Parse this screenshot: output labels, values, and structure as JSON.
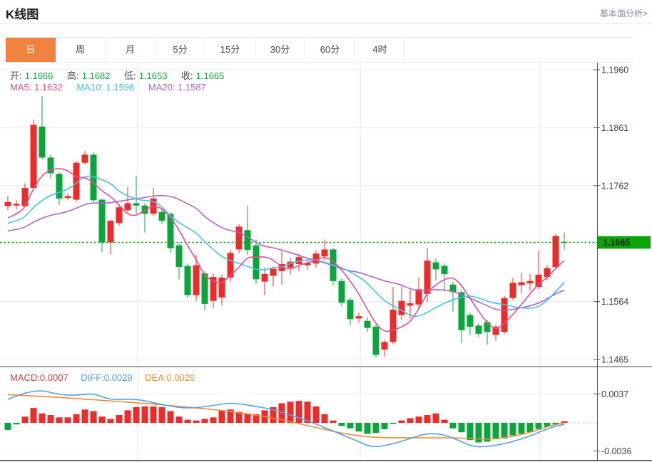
{
  "header": {
    "title": "K线图",
    "link": "基本面分析>"
  },
  "tabs": {
    "items": [
      {
        "label": "日",
        "active": true
      },
      {
        "label": "周",
        "active": false
      },
      {
        "label": "月",
        "active": false
      },
      {
        "label": "5分",
        "active": false
      },
      {
        "label": "15分",
        "active": false
      },
      {
        "label": "30分",
        "active": false
      },
      {
        "label": "60分",
        "active": false
      },
      {
        "label": "4时",
        "active": false
      }
    ]
  },
  "ohlc": {
    "open_label": "开:",
    "open": "1.1666",
    "high_label": "高:",
    "high": "1.1682",
    "low_label": "低:",
    "low": "1.1653",
    "close_label": "收:",
    "close": "1.1665"
  },
  "ma": {
    "ma5": "MA5: 1.1632",
    "ma10": "MA10: 1.1596",
    "ma20": "MA20: 1.1587"
  },
  "macd_header": {
    "macd": "MACD:0.0007",
    "diff": "DIFF:0.0029",
    "dea": "DEA:0.0026"
  },
  "colors": {
    "up": "#ee2b2b",
    "down": "#0ba53c",
    "ma5": "#ec4d8b",
    "ma10": "#45c4e4",
    "ma20": "#b263c6",
    "diff": "#55a0e6",
    "dea": "#ef8d35",
    "price_line": "#12a112",
    "tag_bg": "#0aa30a",
    "tag_text": "#0d2b0d",
    "grid": "#e9edf3",
    "vgrid": "#e2e7ee",
    "axis": "#54575e",
    "zero_dash": "#a8d2ef",
    "tick_text": "#3c3f44",
    "tab_active": "#f0823f"
  },
  "chart_data": {
    "type": "candlestick+macd",
    "title": "K线图 (日)",
    "price_axis": {
      "ticks": [
        1.196,
        1.1861,
        1.1762,
        1.1564,
        1.1465
      ],
      "current": 1.1665,
      "current_label": "1.1665",
      "top_price": 1.196,
      "bottom_price": 1.1465
    },
    "macd_axis": {
      "ticks": [
        0.0037,
        -0.0036
      ]
    },
    "grid_x": [
      193,
      505,
      757
    ],
    "candles": [
      [
        1.1727,
        1.1744,
        1.172,
        1.1734
      ],
      [
        1.1728,
        1.1737,
        1.1722,
        1.1731
      ],
      [
        1.1727,
        1.1766,
        1.1725,
        1.1758
      ],
      [
        1.1758,
        1.1875,
        1.1756,
        1.1866
      ],
      [
        1.1863,
        1.1915,
        1.1807,
        1.181
      ],
      [
        1.181,
        1.1815,
        1.1774,
        1.1783
      ],
      [
        1.1782,
        1.1785,
        1.1729,
        1.174
      ],
      [
        1.1741,
        1.1748,
        1.1737,
        1.1744
      ],
      [
        1.1738,
        1.1804,
        1.1735,
        1.1801
      ],
      [
        1.1801,
        1.1821,
        1.1798,
        1.1815
      ],
      [
        1.1815,
        1.1819,
        1.1734,
        1.1737
      ],
      [
        1.1738,
        1.174,
        1.1648,
        1.1665
      ],
      [
        1.1665,
        1.1704,
        1.1644,
        1.1702
      ],
      [
        1.1698,
        1.1731,
        1.1694,
        1.1725
      ],
      [
        1.172,
        1.176,
        1.1716,
        1.1732
      ],
      [
        1.1732,
        1.1779,
        1.1714,
        1.1728
      ],
      [
        1.1728,
        1.1732,
        1.1682,
        1.1714
      ],
      [
        1.1714,
        1.1758,
        1.171,
        1.174
      ],
      [
        1.1717,
        1.1721,
        1.1697,
        1.1702
      ],
      [
        1.1714,
        1.1716,
        1.1647,
        1.1655
      ],
      [
        1.166,
        1.1663,
        1.1602,
        1.1623
      ],
      [
        1.1625,
        1.1629,
        1.1571,
        1.1575
      ],
      [
        1.1575,
        1.1644,
        1.1565,
        1.1626
      ],
      [
        1.1612,
        1.1616,
        1.1549,
        1.156
      ],
      [
        1.1565,
        1.1612,
        1.1553,
        1.1606
      ],
      [
        1.1571,
        1.161,
        1.1557,
        1.1605
      ],
      [
        1.1605,
        1.1652,
        1.1598,
        1.1647
      ],
      [
        1.1653,
        1.1696,
        1.1646,
        1.1692
      ],
      [
        1.1686,
        1.1728,
        1.1644,
        1.1652
      ],
      [
        1.166,
        1.167,
        1.1594,
        1.1602
      ],
      [
        1.1598,
        1.1622,
        1.1575,
        1.1611
      ],
      [
        1.1608,
        1.1624,
        1.159,
        1.162
      ],
      [
        1.1616,
        1.165,
        1.1593,
        1.1628
      ],
      [
        1.1622,
        1.1638,
        1.161,
        1.1632
      ],
      [
        1.1628,
        1.1645,
        1.1616,
        1.164
      ],
      [
        1.1626,
        1.1636,
        1.1618,
        1.163
      ],
      [
        1.1629,
        1.1652,
        1.1622,
        1.1646
      ],
      [
        1.1641,
        1.167,
        1.1634,
        1.1653
      ],
      [
        1.1653,
        1.1656,
        1.1592,
        1.1599
      ],
      [
        1.1599,
        1.1604,
        1.1556,
        1.1562
      ],
      [
        1.1567,
        1.1571,
        1.1523,
        1.1534
      ],
      [
        1.1535,
        1.1545,
        1.1528,
        1.1539
      ],
      [
        1.1531,
        1.1537,
        1.1512,
        1.1519
      ],
      [
        1.1521,
        1.1525,
        1.1469,
        1.1473
      ],
      [
        1.1482,
        1.1499,
        1.147,
        1.1495
      ],
      [
        1.1495,
        1.1589,
        1.1491,
        1.155
      ],
      [
        1.1541,
        1.1589,
        1.1532,
        1.1565
      ],
      [
        1.1557,
        1.1584,
        1.1535,
        1.1561
      ],
      [
        1.1559,
        1.1605,
        1.1553,
        1.1585
      ],
      [
        1.1577,
        1.1655,
        1.1563,
        1.1634
      ],
      [
        1.1631,
        1.1638,
        1.16,
        1.1619
      ],
      [
        1.1625,
        1.1629,
        1.1581,
        1.1611
      ],
      [
        1.1593,
        1.1598,
        1.1547,
        1.158
      ],
      [
        1.158,
        1.1584,
        1.1493,
        1.1515
      ],
      [
        1.1541,
        1.1545,
        1.1507,
        1.1521
      ],
      [
        1.1523,
        1.1527,
        1.1503,
        1.1509
      ],
      [
        1.1529,
        1.1533,
        1.149,
        1.1512
      ],
      [
        1.1507,
        1.1525,
        1.1497,
        1.1521
      ],
      [
        1.1512,
        1.1574,
        1.1508,
        1.157
      ],
      [
        1.157,
        1.1604,
        1.1566,
        1.1596
      ],
      [
        1.1592,
        1.1613,
        1.1577,
        1.1597
      ],
      [
        1.1595,
        1.1611,
        1.1582,
        1.1599
      ],
      [
        1.1589,
        1.1651,
        1.1585,
        1.161
      ],
      [
        1.1606,
        1.1626,
        1.1601,
        1.1621
      ],
      [
        1.1623,
        1.168,
        1.1619,
        1.1676
      ],
      [
        1.1666,
        1.1682,
        1.1653,
        1.1665
      ]
    ],
    "ma_pads": {
      "ma5": 1.17,
      "ma10": 1.1694,
      "ma20": 1.1682
    },
    "macd": {
      "hist": [
        -0.0009,
        -0.0002,
        0.0008,
        0.0019,
        0.0012,
        0.001,
        0.0007,
        0.0007,
        0.0011,
        0.0017,
        0.0015,
        0.0008,
        0.0005,
        0.001,
        0.0016,
        0.002,
        0.0021,
        0.0021,
        0.002,
        0.0015,
        0.0008,
        0.0004,
        0.0003,
        0.0005,
        0.0007,
        0.0016,
        0.0017,
        0.0014,
        0.0012,
        0.0011,
        0.0016,
        0.002,
        0.0025,
        0.0027,
        0.0028,
        0.0027,
        0.0021,
        0.0011,
        0.0003,
        -0.0004,
        -0.0007,
        -0.0011,
        -0.0014,
        -0.0013,
        -0.0008,
        -0.0001,
        0.0003,
        0.0006,
        0.0008,
        0.001,
        0.0012,
        0.0004,
        -0.0007,
        -0.0012,
        -0.0022,
        -0.0025,
        -0.0024,
        -0.0021,
        -0.002,
        -0.0016,
        -0.0014,
        -0.0012,
        -0.0008,
        -0.0005,
        -0.0002,
        0.0002
      ],
      "diff_points": [
        [
          1,
          0.003
        ],
        [
          4,
          0.0044
        ],
        [
          7,
          0.0036
        ],
        [
          9,
          0.0035
        ],
        [
          11,
          0.0038
        ],
        [
          13,
          0.0029
        ],
        [
          16,
          0.0031
        ],
        [
          19,
          0.0023
        ],
        [
          22,
          0.0018
        ],
        [
          25,
          0.0022
        ],
        [
          27,
          0.0026
        ],
        [
          30,
          0.0021
        ],
        [
          32,
          0.0017
        ],
        [
          34,
          0.001
        ],
        [
          36,
          0.0003
        ],
        [
          38,
          -0.0006
        ],
        [
          40,
          -0.0015
        ],
        [
          42,
          -0.0024
        ],
        [
          43,
          -0.0029
        ],
        [
          44,
          -0.0031
        ],
        [
          46,
          -0.0027
        ],
        [
          48,
          -0.002
        ],
        [
          50,
          -0.0013
        ],
        [
          52,
          -0.0015
        ],
        [
          54,
          -0.0024
        ],
        [
          55,
          -0.0029
        ],
        [
          56,
          -0.0031
        ],
        [
          58,
          -0.0029
        ],
        [
          60,
          -0.0024
        ],
        [
          62,
          -0.0017
        ],
        [
          63,
          -0.0012
        ],
        [
          64,
          -0.0008
        ],
        [
          65,
          -0.0004
        ],
        [
          66,
          -0.0002
        ]
      ],
      "dea_points": [
        [
          1,
          0.0036
        ],
        [
          5,
          0.0034
        ],
        [
          9,
          0.0031
        ],
        [
          13,
          0.0028
        ],
        [
          17,
          0.0025
        ],
        [
          21,
          0.0021
        ],
        [
          25,
          0.0017
        ],
        [
          28,
          0.0013
        ],
        [
          31,
          0.0008
        ],
        [
          33,
          0.0004
        ],
        [
          35,
          -0.0001
        ],
        [
          37,
          -0.0006
        ],
        [
          39,
          -0.0011
        ],
        [
          41,
          -0.0015
        ],
        [
          43,
          -0.0018
        ],
        [
          45,
          -0.0019
        ],
        [
          49,
          -0.0019
        ],
        [
          53,
          -0.0019
        ],
        [
          55,
          -0.002
        ],
        [
          57,
          -0.0021
        ],
        [
          59,
          -0.0019
        ],
        [
          61,
          -0.0015
        ],
        [
          62,
          -0.0012
        ],
        [
          63,
          -0.0009
        ],
        [
          64,
          -0.0005
        ],
        [
          65,
          -0.0002
        ],
        [
          66,
          0.0
        ]
      ]
    }
  }
}
